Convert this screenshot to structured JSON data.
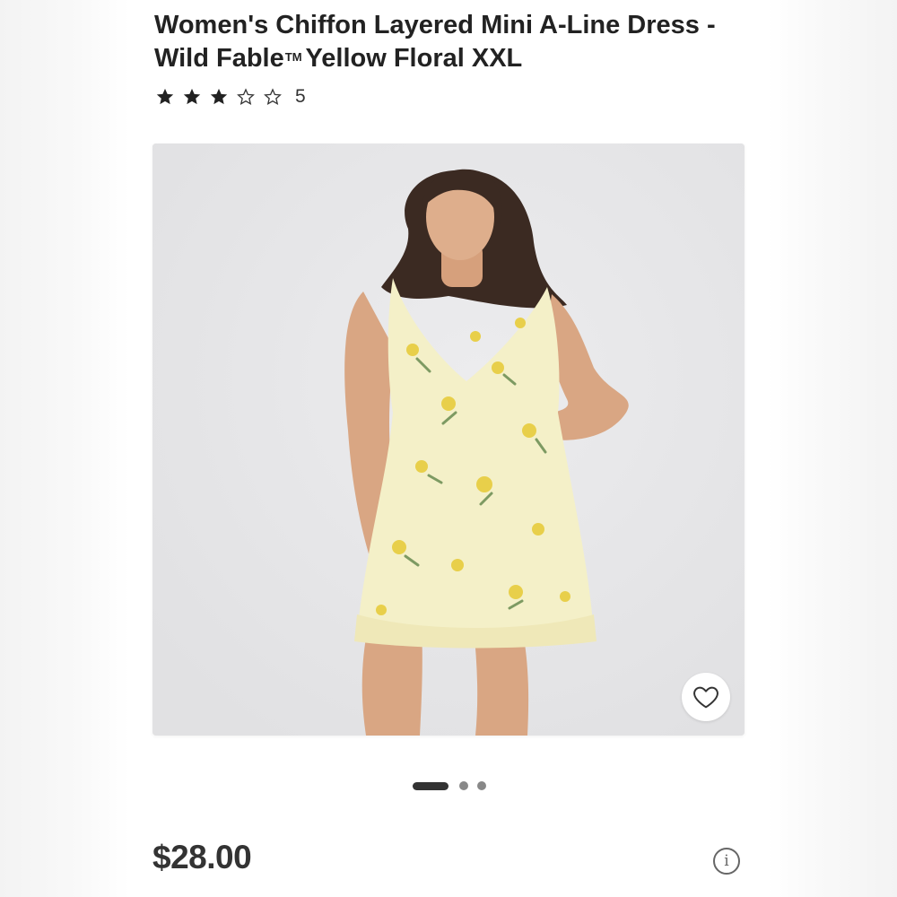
{
  "product": {
    "title_line1": "Women's Chiffon Layered Mini A-Line Dress -",
    "title_brand": "Wild Fable",
    "title_tm": "TM",
    "title_rest": "Yellow Floral XXL",
    "rating_value": 3,
    "rating_max": 5,
    "rating_count": "5",
    "price": "$28.00"
  },
  "gallery": {
    "image_count": 3,
    "active_index": 0,
    "favorite_icon": "heart-outline-icon",
    "info_icon": "info-circle-icon",
    "info_glyph": "i"
  },
  "colors": {
    "text_primary": "#222222",
    "card_background": "#e5e5e7",
    "dress": "#f4f0c8",
    "flower": "#e8cf4a"
  }
}
